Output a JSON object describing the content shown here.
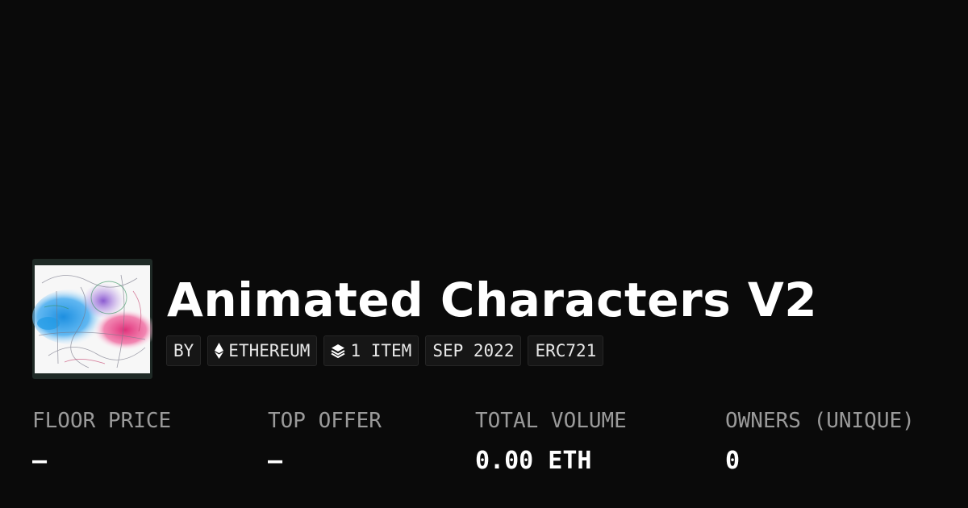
{
  "collection": {
    "title": "Animated Characters V2",
    "thumbnail_alt": "collection-artwork"
  },
  "badges": [
    {
      "label": "BY",
      "icon": "none"
    },
    {
      "label": "ETHEREUM",
      "icon": "ethereum-icon"
    },
    {
      "label": "1 ITEM",
      "icon": "layers-icon"
    },
    {
      "label": "SEP 2022",
      "icon": "none"
    },
    {
      "label": "ERC721",
      "icon": "none"
    }
  ],
  "stats": [
    {
      "label": "FLOOR PRICE",
      "value": "–"
    },
    {
      "label": "TOP OFFER",
      "value": "–"
    },
    {
      "label": "TOTAL VOLUME",
      "value": "0.00 ETH"
    },
    {
      "label": "OWNERS (UNIQUE)",
      "value": "0"
    }
  ],
  "colors": {
    "background": "#0a0a0a",
    "text": "#ffffff",
    "muted": "#9a9a9a",
    "badge_bg": "#161616"
  }
}
